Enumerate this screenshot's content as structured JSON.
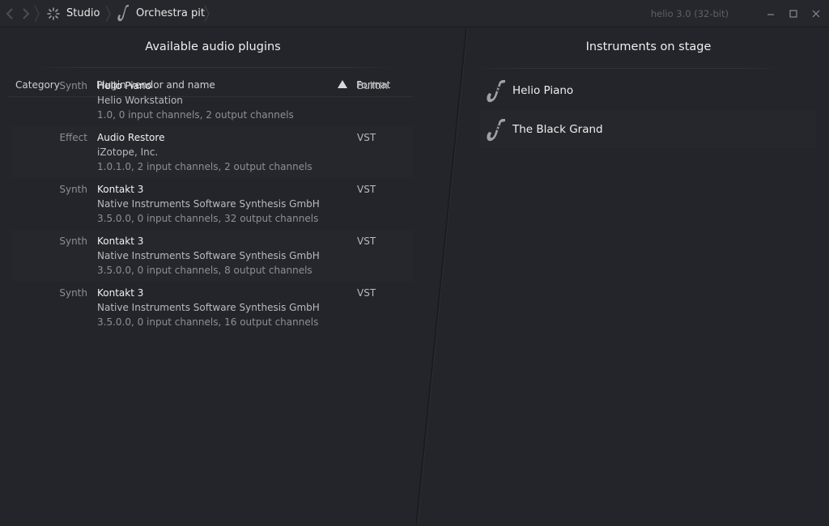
{
  "titlebar": {
    "breadcrumbs": [
      {
        "label": "Studio",
        "icon": "sun-spinner-icon"
      },
      {
        "label": "Orchestra pit",
        "icon": "saxophone-icon"
      }
    ],
    "version": "helio 3.0 (32-bit)",
    "window_buttons": [
      "minimize-icon",
      "maximize-icon",
      "close-icon"
    ]
  },
  "plugins": {
    "title": "Available audio plugins",
    "columns": {
      "category": "Category",
      "name": "Plugin vendor and name",
      "format": "Format"
    },
    "sort_indicator": "ascending-triangle-icon",
    "rows": [
      {
        "category": "Synth",
        "name": "Helio Piano",
        "vendor": "Helio Workstation",
        "desc": "1.0, 0 input channels, 2 output channels",
        "format": "BuiltIn"
      },
      {
        "category": "Effect",
        "name": "Audio Restore",
        "vendor": "iZotope, Inc.",
        "desc": "1.0.1.0, 2 input channels, 2 output channels",
        "format": "VST"
      },
      {
        "category": "Synth",
        "name": "Kontakt 3",
        "vendor": "Native Instruments Software Synthesis GmbH",
        "desc": "3.5.0.0, 0 input channels, 32 output channels",
        "format": "VST"
      },
      {
        "category": "Synth",
        "name": "Kontakt 3",
        "vendor": "Native Instruments Software Synthesis GmbH",
        "desc": "3.5.0.0, 0 input channels, 8 output channels",
        "format": "VST"
      },
      {
        "category": "Synth",
        "name": "Kontakt 3",
        "vendor": "Native Instruments Software Synthesis GmbH",
        "desc": "3.5.0.0, 0 input channels, 16 output channels",
        "format": "VST"
      }
    ]
  },
  "instruments": {
    "title": "Instruments on stage",
    "items": [
      {
        "label": "Helio Piano",
        "icon": "saxophone-icon"
      },
      {
        "label": "The Black Grand",
        "icon": "saxophone-icon"
      }
    ]
  },
  "colors": {
    "background": "#24252a",
    "row_alt": "#26272c",
    "text_primary": "#efeff0",
    "text_muted": "#8e8f94"
  }
}
